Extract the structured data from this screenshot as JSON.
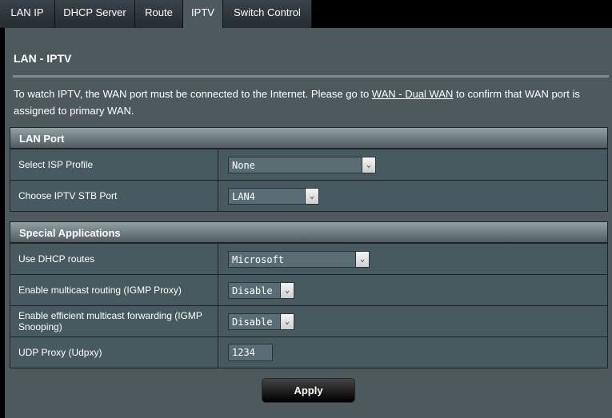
{
  "tabs": [
    {
      "label": "LAN IP"
    },
    {
      "label": "DHCP Server"
    },
    {
      "label": "Route"
    },
    {
      "label": "IPTV"
    },
    {
      "label": "Switch Control"
    }
  ],
  "page": {
    "title": "LAN - IPTV",
    "info_before": "To watch IPTV, the WAN port must be connected to the Internet. Please go to ",
    "info_link": "WAN - Dual WAN",
    "info_after": " to confirm that WAN port is assigned to primary WAN."
  },
  "lan_port": {
    "header": "LAN Port",
    "isp_profile_label": "Select ISP Profile",
    "isp_profile_value": "None",
    "stb_port_label": "Choose IPTV STB Port",
    "stb_port_value": "LAN4"
  },
  "special_apps": {
    "header": "Special Applications",
    "dhcp_routes_label": "Use DHCP routes",
    "dhcp_routes_value": "Microsoft",
    "igmp_proxy_label": "Enable multicast routing (IGMP Proxy)",
    "igmp_proxy_value": "Disable",
    "igmp_snooping_label": "Enable efficient multicast forwarding (IGMP Snooping)",
    "igmp_snooping_value": "Disable",
    "udpxy_label": "UDP Proxy (Udpxy)",
    "udpxy_value": "1234"
  },
  "actions": {
    "apply_label": "Apply"
  }
}
